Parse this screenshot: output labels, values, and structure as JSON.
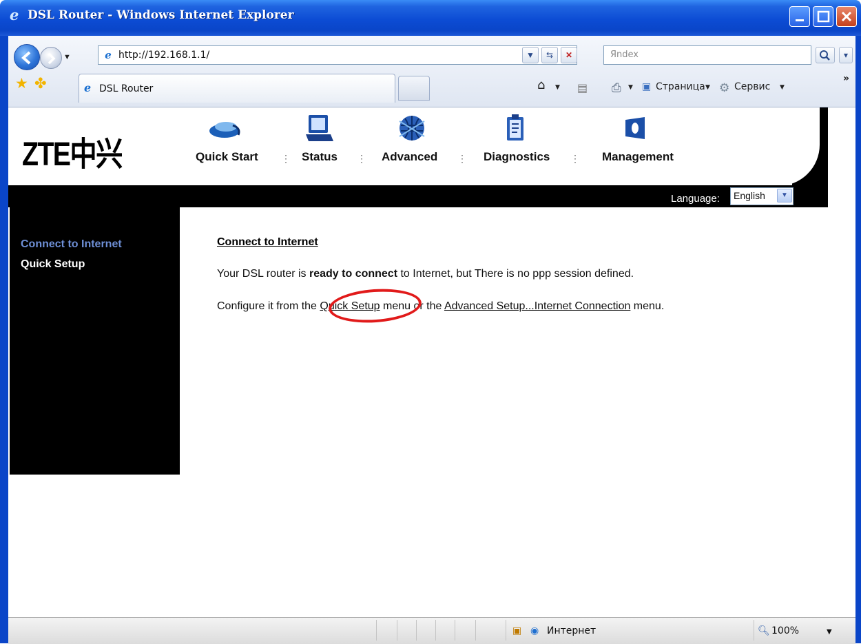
{
  "window": {
    "title": "DSL Router - Windows Internet Explorer"
  },
  "browser": {
    "address": "http://192.168.1.1/",
    "search_placeholder": "Яndex",
    "tab_title": "DSL Router",
    "toolbar": {
      "page_label": "Страница",
      "tools_label": "Сервис"
    }
  },
  "router": {
    "logo_text": "ZTE中兴",
    "menu": [
      {
        "label": "Quick Start",
        "icon": "quick-start-icon"
      },
      {
        "label": "Status",
        "icon": "laptop-icon"
      },
      {
        "label": "Advanced",
        "icon": "globe-icon"
      },
      {
        "label": "Diagnostics",
        "icon": "clipboard-icon"
      },
      {
        "label": "Management",
        "icon": "device-icon"
      }
    ],
    "language_label": "Language:",
    "language_value": "English",
    "sidebar": [
      {
        "label": "Connect to Internet",
        "color": "#6e8fd6"
      },
      {
        "label": "Quick Setup",
        "color": "#ffffff"
      }
    ],
    "content": {
      "heading": "Connect to Internet",
      "line1_pre": "Your DSL router is ",
      "line1_bold": "ready to connect",
      "line1_post": " to Internet, but There is no ppp session defined.",
      "line2_pre": "Configure it from the ",
      "line2_link1": "Quick Setup",
      "line2_mid": " menu or the ",
      "line2_link2": "Advanced Setup...Internet Connection",
      "line2_post": " menu."
    }
  },
  "statusbar": {
    "zone": "Интернет",
    "zoom": "100%"
  },
  "colors": {
    "titlebar": "#0a45c8",
    "annotation": "#e11a1a"
  }
}
